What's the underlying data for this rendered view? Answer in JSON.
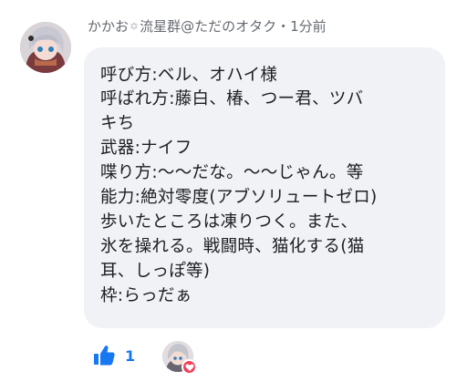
{
  "comment": {
    "author": "かかお",
    "author_tail": "流星群@ただのオタク",
    "separator": "・",
    "time": "1分前",
    "lines": [
      "呼び方:ベル、オハイ様",
      "呼ばれ方:藤白、椿、つー君、ツバ",
      "キち",
      "武器:ナイフ",
      "喋り方:〜〜だな。〜〜じゃん。等",
      "能力:絶対零度(アブソリュートゼロ)",
      "歩いたところは凍りつく。また、",
      "氷を操れる。戦闘時、猫化する(猫",
      "耳、しっぽ等)",
      "枠:らっだぁ"
    ]
  },
  "reactions": {
    "like_count": "1",
    "icons": [
      "like-icon",
      "heart-icon",
      "star-icon"
    ]
  },
  "colors": {
    "bubble": "#f0f2f5",
    "text": "#1c1e21",
    "meta": "#666a70",
    "like_blue": "#1877f2",
    "heart_red": "#f33e58"
  }
}
